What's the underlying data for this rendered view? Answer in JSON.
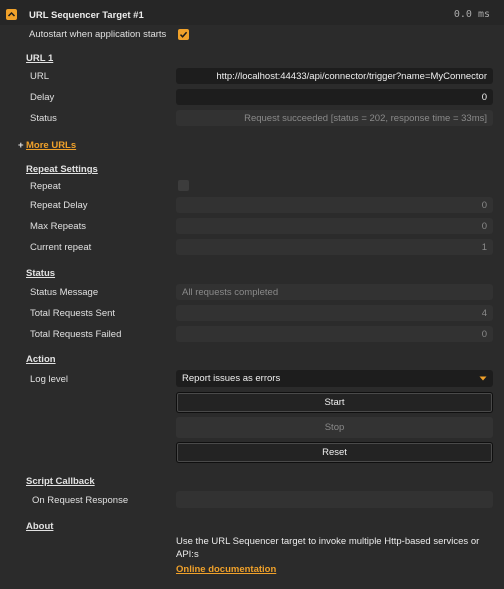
{
  "header": {
    "title": "URL Sequencer Target #1",
    "timer": "0.0 ms"
  },
  "autostart": {
    "label": "Autostart when application starts",
    "checked": true
  },
  "url1": {
    "section": "URL 1",
    "url_label": "URL",
    "url_value": "http://localhost:44433/api/connector/trigger?name=MyConnector",
    "delay_label": "Delay",
    "delay_value": "0",
    "status_label": "Status",
    "status_value": "Request succeeded [status = 202, response time = 33ms]"
  },
  "more_urls": {
    "plus": "+",
    "label": "More URLs"
  },
  "repeat": {
    "section": "Repeat Settings",
    "repeat_label": "Repeat",
    "repeat_checked": false,
    "repeat_delay_label": "Repeat Delay",
    "repeat_delay_value": "0",
    "max_repeats_label": "Max Repeats",
    "max_repeats_value": "0",
    "current_repeat_label": "Current repeat",
    "current_repeat_value": "1"
  },
  "status": {
    "section": "Status",
    "message_label": "Status Message",
    "message_value": "All requests completed",
    "sent_label": "Total Requests Sent",
    "sent_value": "4",
    "failed_label": "Total Requests Failed",
    "failed_value": "0"
  },
  "action": {
    "section": "Action",
    "log_level_label": "Log level",
    "log_level_value": "Report issues as errors",
    "start_label": "Start",
    "stop_label": "Stop",
    "reset_label": "Reset"
  },
  "script_callback": {
    "section": "Script Callback",
    "on_response_label": "On Request Response",
    "on_response_value": ""
  },
  "about": {
    "section": "About",
    "description": "Use the URL Sequencer target to invoke multiple Http-based services or API:s",
    "doc_link": "Online documentation"
  },
  "colors": {
    "accent": "#f0a12a",
    "background": "#2b2b2b",
    "input_bg": "#1d1d1d",
    "readonly_bg": "#323232"
  },
  "icons": {
    "collapse": "chevron-up-icon",
    "checkmark": "checkmark-icon",
    "dropdown": "caret-down-icon"
  }
}
